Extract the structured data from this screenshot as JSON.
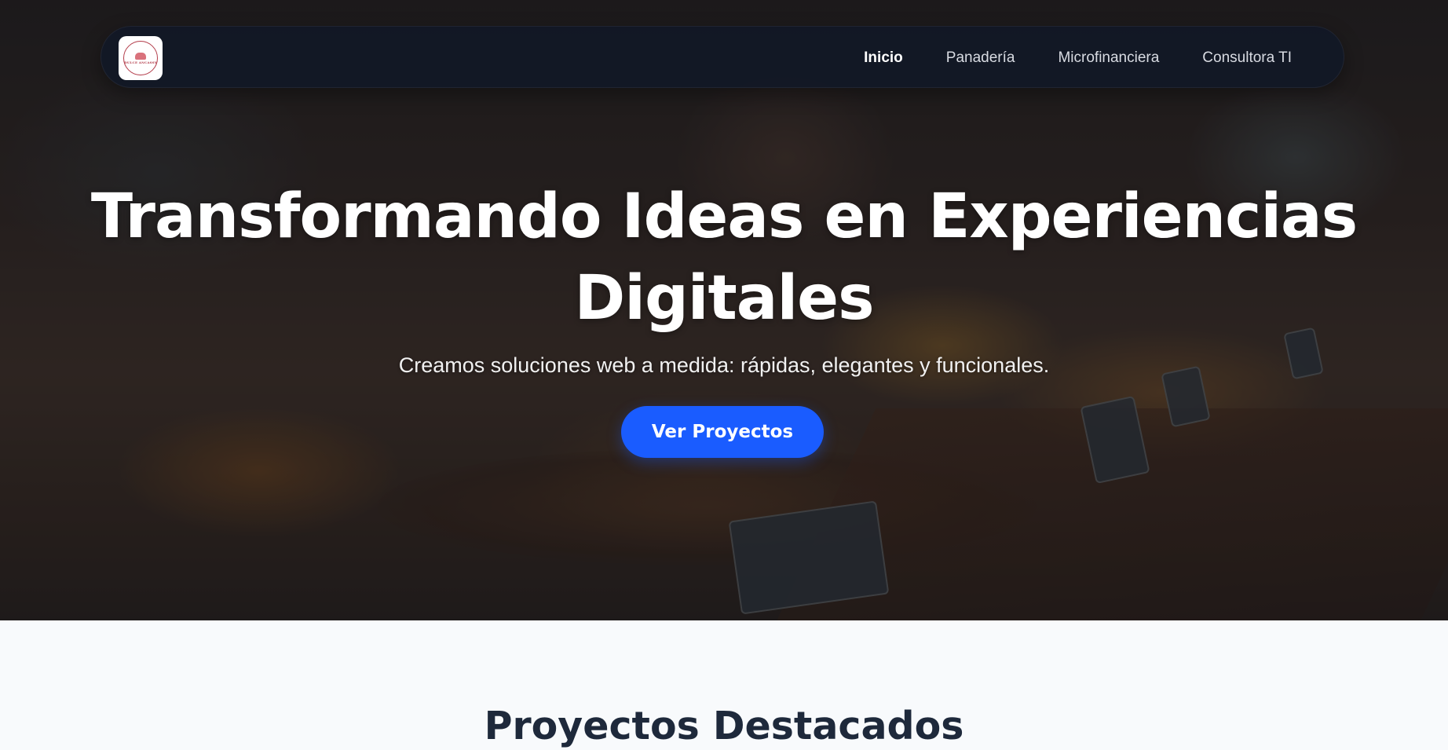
{
  "navbar": {
    "logo": {
      "icon": "bakery-seal-logo",
      "text": "DULCE ANCASSY"
    },
    "links": [
      {
        "label": "Inicio",
        "active": true
      },
      {
        "label": "Panadería",
        "active": false
      },
      {
        "label": "Microfinanciera",
        "active": false
      },
      {
        "label": "Consultora TI",
        "active": false
      }
    ]
  },
  "hero": {
    "title_line1": "Transformando Ideas en Experiencias",
    "title_line2": "Digitales",
    "subtitle": "Creamos soluciones web a medida: rápidas, elegantes y funcionales.",
    "cta_label": "Ver Proyectos",
    "background": "bakery-pastries-photo"
  },
  "projects": {
    "title": "Proyectos Destacados"
  },
  "colors": {
    "accent": "#1a5cff",
    "navbar_bg": "#111827",
    "section_bg": "#f8fafc",
    "heading_dark": "#1e293b"
  }
}
